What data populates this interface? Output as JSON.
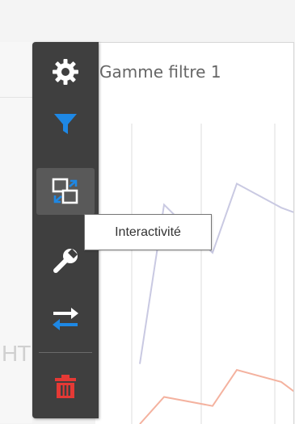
{
  "background": {
    "partial_text": "HT"
  },
  "widget": {
    "title": "Gamme filtre 1"
  },
  "chart_data": {
    "type": "line",
    "title": "Gamme filtre 1",
    "xlabel": "",
    "ylabel": "",
    "grid": true,
    "series": [
      {
        "color": "#c9c9e2",
        "points": [
          [
            0,
            20
          ],
          [
            1,
            73
          ],
          [
            2,
            57
          ],
          [
            3,
            80
          ],
          [
            4,
            72
          ],
          [
            5,
            70
          ]
        ]
      },
      {
        "color": "#f4b29f",
        "points": [
          [
            0,
            0
          ],
          [
            1,
            9
          ],
          [
            2,
            6
          ],
          [
            3,
            18
          ],
          [
            4,
            14
          ],
          [
            5,
            10
          ]
        ]
      }
    ],
    "ylim": [
      0,
      100
    ]
  },
  "toolbar": {
    "items": [
      {
        "name": "settings",
        "icon": "gear-icon",
        "color": "#ffffff",
        "active": false
      },
      {
        "name": "filter",
        "icon": "filter-icon",
        "color": "#1e88e5",
        "active": false
      },
      {
        "name": "interactivity",
        "icon": "interactivity-icon",
        "color": "#ffffff",
        "active": true
      },
      {
        "name": "tools",
        "icon": "wrench-icon",
        "color": "#ffffff",
        "active": false
      },
      {
        "name": "swap",
        "icon": "swap-arrows-icon",
        "color": "#ffffff",
        "active": false
      },
      {
        "name": "delete",
        "icon": "trash-icon",
        "color": "#e53935",
        "active": false
      }
    ]
  },
  "tooltip": {
    "text": "Interactivité"
  },
  "colors": {
    "toolbar_bg": "#3f3f3f",
    "active_bg": "#595959",
    "accent_blue": "#1e88e5",
    "danger_red": "#e53935"
  }
}
